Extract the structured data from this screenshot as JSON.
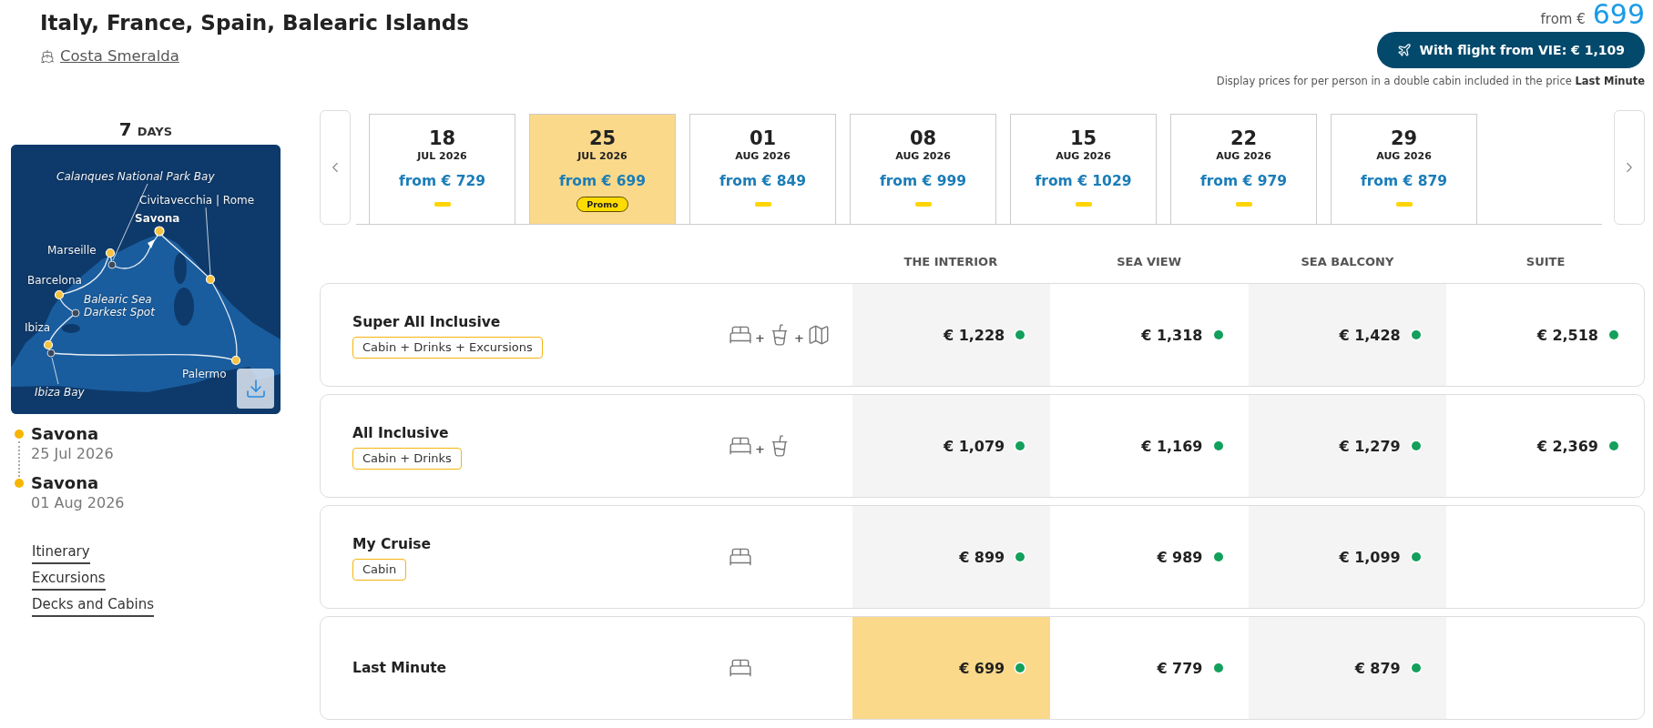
{
  "header": {
    "title": "Italy, France, Spain, Balearic Islands",
    "ship": "Costa Smeralda",
    "from_label": "from €",
    "from_price": "699",
    "flight_button": "With flight from VIE: € 1,109",
    "note": "Display prices for per person in a double cabin included in the price **Last Minute**"
  },
  "duration": {
    "number": "7",
    "unit": "DAYS"
  },
  "map": {
    "places": [
      {
        "name": "Calanques National Park Bay",
        "kind": "scenic"
      },
      {
        "name": "Civitavecchia | Rome",
        "kind": "port"
      },
      {
        "name": "Savona",
        "kind": "home"
      },
      {
        "name": "Marseille",
        "kind": "port"
      },
      {
        "name": "Barcelona",
        "kind": "port"
      },
      {
        "name": "Balearic Sea Darkest Spot",
        "kind": "scenic"
      },
      {
        "name": "Ibiza",
        "kind": "port"
      },
      {
        "name": "Palermo",
        "kind": "port"
      },
      {
        "name": "Ibiza Bay",
        "kind": "scenic"
      }
    ]
  },
  "stops": [
    {
      "place": "Savona",
      "date": "25 Jul 2026"
    },
    {
      "place": "Savona",
      "date": "01 Aug 2026"
    }
  ],
  "links": [
    {
      "label": "Itinerary"
    },
    {
      "label": "Excursions"
    },
    {
      "label": "Decks and Cabins"
    }
  ],
  "dates": [
    {
      "day": "18",
      "month": "JUL 2026",
      "price": "from € 729",
      "selected": false
    },
    {
      "day": "25",
      "month": "JUL 2026",
      "price": "from € 699",
      "selected": true,
      "badge": "Promo"
    },
    {
      "day": "01",
      "month": "AUG 2026",
      "price": "from € 849",
      "selected": false
    },
    {
      "day": "08",
      "month": "AUG 2026",
      "price": "from € 999",
      "selected": false
    },
    {
      "day": "15",
      "month": "AUG 2026",
      "price": "from € 1029",
      "selected": false
    },
    {
      "day": "22",
      "month": "AUG 2026",
      "price": "from € 979",
      "selected": false
    },
    {
      "day": "29",
      "month": "AUG 2026",
      "price": "from € 879",
      "selected": false
    }
  ],
  "fares": {
    "columns": [
      "THE INTERIOR",
      "SEA VIEW",
      "SEA BALCONY",
      "SUITE"
    ],
    "rows": [
      {
        "name": "Super All Inclusive",
        "tag": "Cabin + Drinks + Excursions",
        "includes": [
          {
            "kind": "cabin"
          },
          {
            "kind": "plus",
            "text": "+"
          },
          {
            "kind": "drinks"
          },
          {
            "kind": "plus",
            "text": "+"
          },
          {
            "kind": "excursions"
          }
        ],
        "prices": [
          {
            "value": "€ 1,228",
            "selected": false,
            "available": true
          },
          {
            "value": "€ 1,318",
            "selected": false,
            "available": true
          },
          {
            "value": "€ 1,428",
            "selected": false,
            "available": true
          },
          {
            "value": "€ 2,518",
            "selected": false,
            "available": true
          }
        ]
      },
      {
        "name": "All Inclusive",
        "tag": "Cabin + Drinks",
        "includes": [
          {
            "kind": "cabin"
          },
          {
            "kind": "plus",
            "text": "+"
          },
          {
            "kind": "drinks"
          }
        ],
        "prices": [
          {
            "value": "€ 1,079",
            "selected": false,
            "available": true
          },
          {
            "value": "€ 1,169",
            "selected": false,
            "available": true
          },
          {
            "value": "€ 1,279",
            "selected": false,
            "available": true
          },
          {
            "value": "€ 2,369",
            "selected": false,
            "available": true
          }
        ]
      },
      {
        "name": "My Cruise",
        "tag": "Cabin",
        "includes": [
          {
            "kind": "cabin"
          }
        ],
        "prices": [
          {
            "value": "€ 899",
            "selected": false,
            "available": true
          },
          {
            "value": "€ 989",
            "selected": false,
            "available": true
          },
          {
            "value": "€ 1,099",
            "selected": false,
            "available": true
          }
        ]
      },
      {
        "name": "Last Minute",
        "includes": [
          {
            "kind": "cabin"
          }
        ],
        "prices": [
          {
            "value": "€ 699",
            "selected": true,
            "available": true
          },
          {
            "value": "€ 779",
            "selected": false,
            "available": true
          },
          {
            "value": "€ 879",
            "selected": false,
            "available": true
          }
        ]
      }
    ]
  }
}
